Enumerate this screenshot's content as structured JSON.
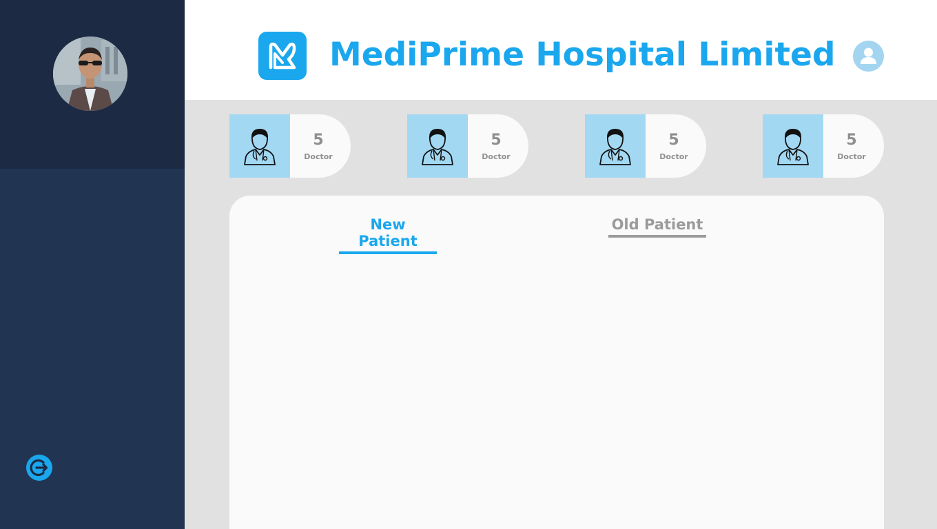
{
  "app": {
    "title": "MediPrime Hospital Limited",
    "accent_color": "#1aa7ee"
  },
  "sidebar": {
    "avatar_icon": "user-photo",
    "logout_icon": "logout-icon"
  },
  "header": {
    "logo_icon": "mediprime-logo-icon",
    "profile_icon": "user-profile-icon"
  },
  "stats": [
    {
      "value": "5",
      "label": "Doctor",
      "icon": "doctor-icon"
    },
    {
      "value": "5",
      "label": "Doctor",
      "icon": "doctor-icon"
    },
    {
      "value": "5",
      "label": "Doctor",
      "icon": "doctor-icon"
    },
    {
      "value": "5",
      "label": "Doctor",
      "icon": "doctor-icon"
    }
  ],
  "tabs": [
    {
      "label": "New Patient",
      "active": true
    },
    {
      "label": "Old Patient",
      "active": false
    }
  ]
}
